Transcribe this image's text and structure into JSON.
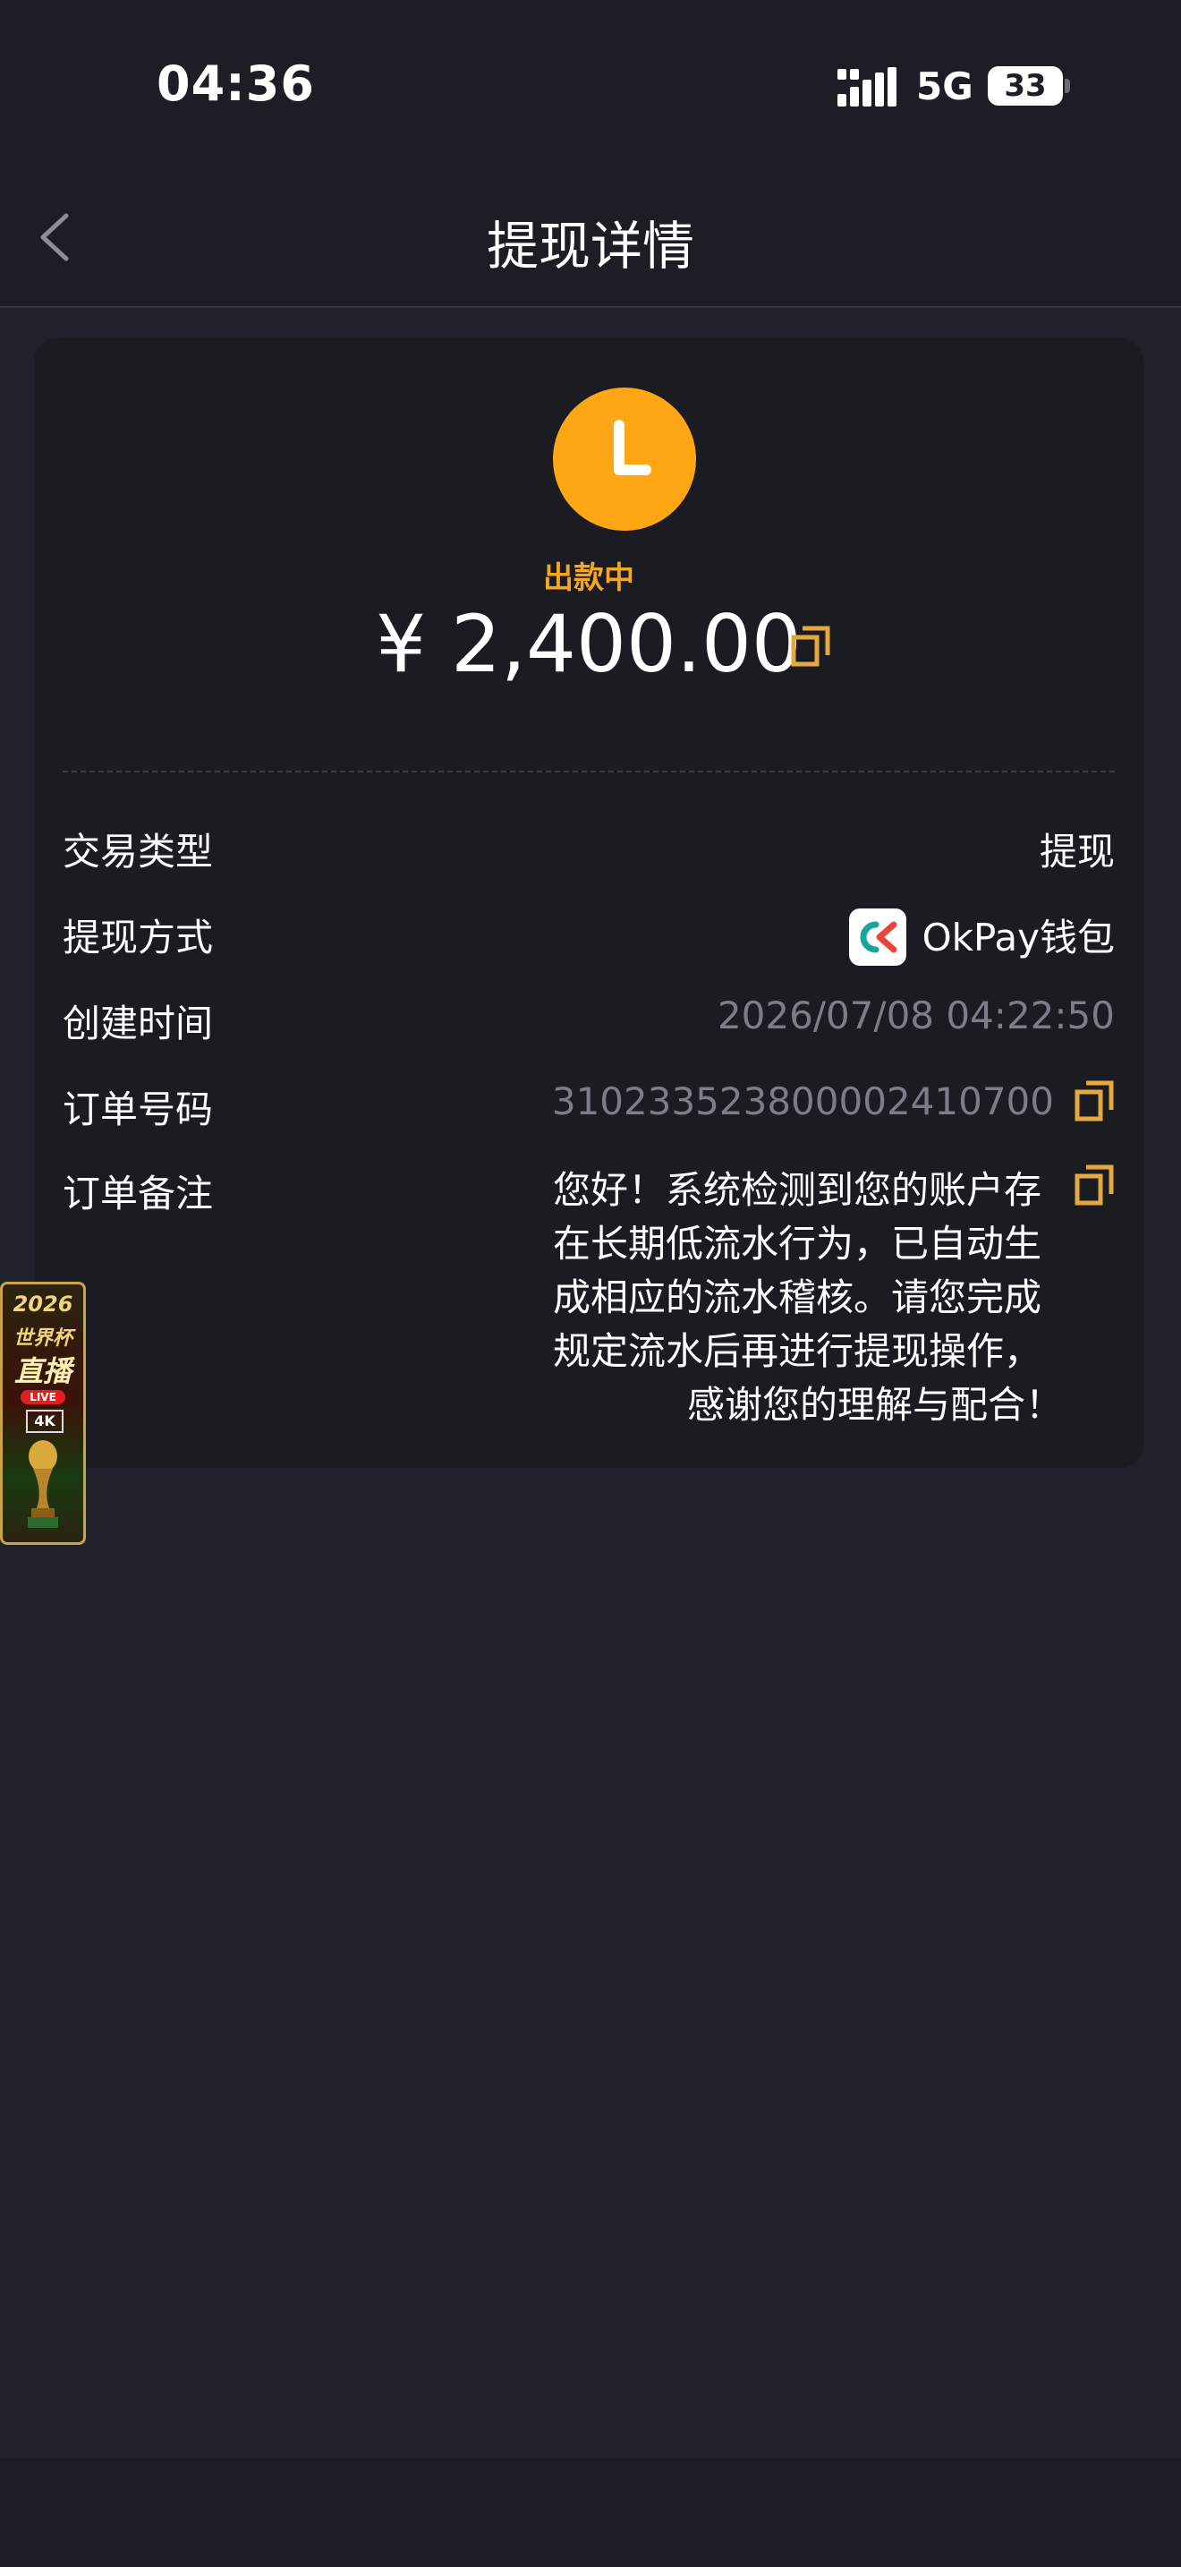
{
  "status_bar": {
    "time": "04:36",
    "network": "5G",
    "battery": "33"
  },
  "header": {
    "title": "提现详情"
  },
  "summary": {
    "status_text": "出款中",
    "amount": "¥ 2,400.00",
    "status_color": "#ffa615"
  },
  "details": {
    "type_label": "交易类型",
    "type_value": "提现",
    "method_label": "提现方式",
    "method_value": "OkPay钱包",
    "created_label": "创建时间",
    "created_value": "2026/07/08 04:22:50",
    "order_label": "订单号码",
    "order_value": "310233523800002410700",
    "remark_label": "订单备注",
    "remark_lines": [
      "您好！系统检测到您的账户存",
      "在长期低流水行为，已自动生",
      "成相应的流水稽核。请您完成",
      "规定流水后再进行提现操作，",
      "感谢您的理解与配合！"
    ]
  },
  "promo": {
    "year": "2026",
    "line1": "世界杯",
    "line2": "直播",
    "live": "LIVE",
    "quality": "4K"
  },
  "icons": {
    "back": "chevron-left-icon",
    "copy": "copy-icon",
    "status": "clock-icon",
    "wallet": "okpay-logo-icon"
  },
  "colors": {
    "accent": "#f5a623",
    "background": "#20222b",
    "card": "#1b1c22",
    "muted": "#7b7e88"
  }
}
